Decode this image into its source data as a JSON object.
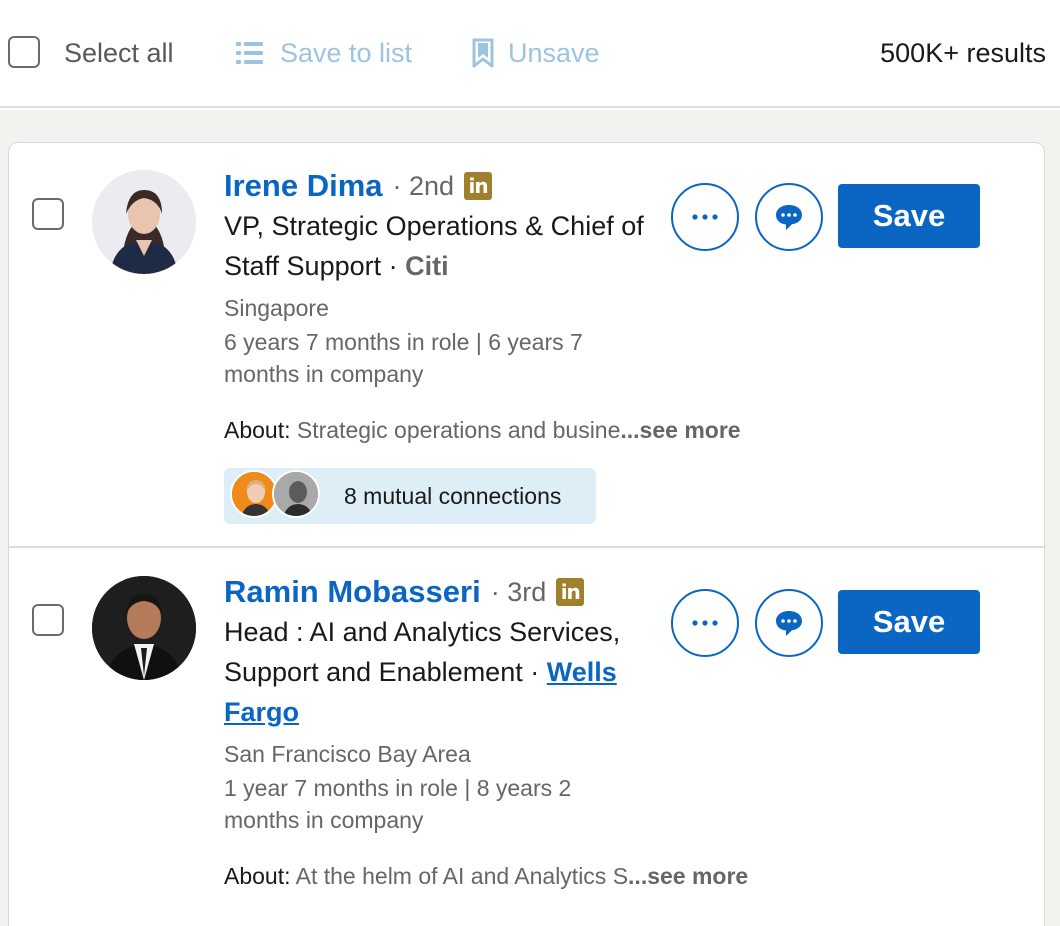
{
  "toolbar": {
    "select_all": "Select all",
    "save_to_list": "Save to list",
    "save_to_list_icon": "list-icon",
    "unsave": "Unsave",
    "unsave_icon": "bookmark-icon",
    "results": "500K+ results"
  },
  "people": [
    {
      "name": "Irene Dima",
      "degree": "· 2nd",
      "badge": "in",
      "headline": "VP, Strategic Operations & Chief of Staff Support · ",
      "company": "Citi",
      "location": "Singapore",
      "tenure": "6 years 7 months in role | 6 years 7 months in company",
      "about_label": "About:",
      "about_text": "Strategic operations and busine",
      "see_more": "...see more",
      "mutual": "8 mutual connections",
      "save_label": "Save"
    },
    {
      "name": "Ramin Mobasseri",
      "degree": "· 3rd",
      "badge": "in",
      "headline": "Head : AI and Analytics Services, Support and Enablement · ",
      "company": "Wells Fargo",
      "location": "San Francisco Bay Area",
      "tenure": "1 year 7 months in role | 8 years 2 months in company",
      "about_label": "About:",
      "about_text": "At the helm of AI and Analytics S",
      "see_more": "...see more",
      "save_label": "Save"
    }
  ],
  "colors": {
    "accent": "#0a66c2",
    "disabled_accent": "#9cc4e2",
    "premium_badge": "#a0802c",
    "mutual_bg": "#ddeef6"
  }
}
